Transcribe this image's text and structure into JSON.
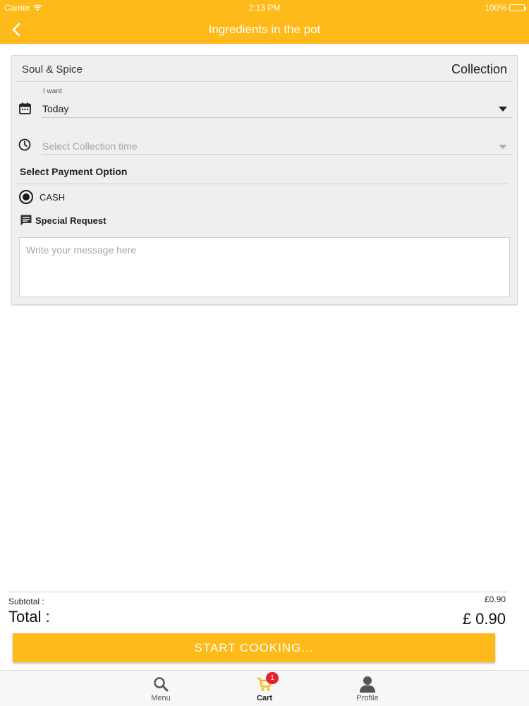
{
  "status_bar": {
    "carrier": "Carrier",
    "time": "2:13 PM",
    "battery": "100%"
  },
  "header": {
    "title": "Ingredients in the pot",
    "back_icon": "chevron-left-icon"
  },
  "order_card": {
    "restaurant_name": "Soul & Spice",
    "order_type": "Collection",
    "date_field": {
      "label": "I want",
      "value": "Today",
      "icon": "calendar-icon"
    },
    "time_field": {
      "placeholder": "Select Collection time",
      "icon": "clock-icon"
    },
    "payment": {
      "title": "Select Payment Option",
      "options": [
        {
          "label": "CASH",
          "selected": true
        }
      ]
    },
    "special_request": {
      "title": "Special Request",
      "icon": "message-icon",
      "placeholder": "Write your message here"
    }
  },
  "totals": {
    "subtotal_label": "Subtotal :",
    "subtotal_value": "£0.90",
    "total_label": "Total :",
    "total_value": "£ 0.90"
  },
  "cta": {
    "label": "START COOKING..."
  },
  "tab_bar": {
    "tabs": [
      {
        "label": "Menu",
        "icon": "search-icon"
      },
      {
        "label": "Cart",
        "icon": "cart-icon",
        "badge": "1",
        "active": true
      },
      {
        "label": "Profile",
        "icon": "person-icon"
      }
    ]
  },
  "colors": {
    "accent": "#FDBA19",
    "badge": "#E8202B",
    "card_bg": "#EFEFF1"
  }
}
